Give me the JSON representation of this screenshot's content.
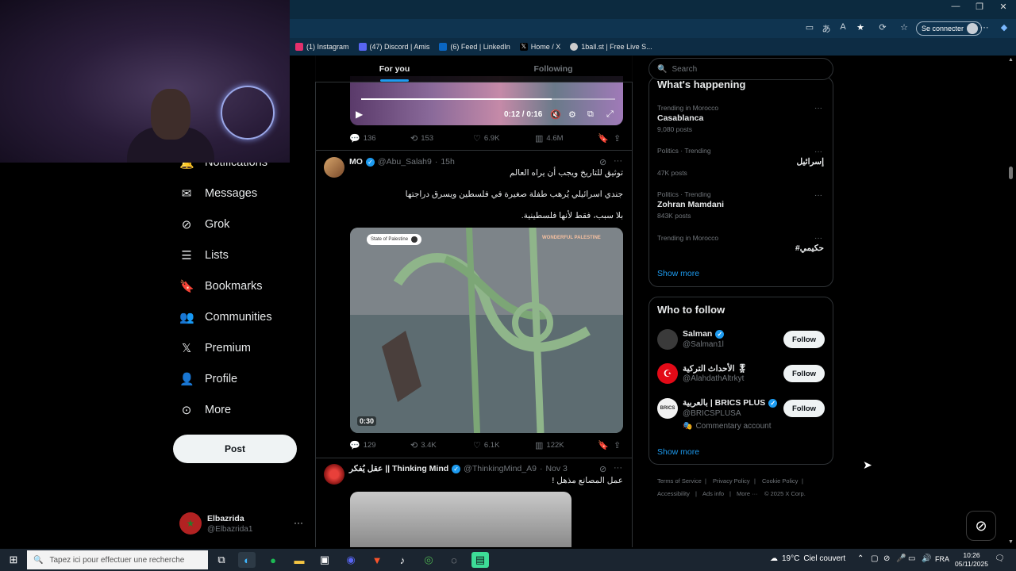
{
  "browser": {
    "window_controls": [
      "minimize",
      "restore",
      "close"
    ],
    "signin_label": "Se connecter",
    "favorites": [
      {
        "label": "(1) Instagram",
        "icon": "instagram-icon",
        "color": "#e1306c"
      },
      {
        "label": "(47) Discord | Amis",
        "icon": "discord-icon",
        "color": "#5865f2"
      },
      {
        "label": "(6) Feed | LinkedIn",
        "icon": "linkedin-icon",
        "color": "#0a66c2"
      },
      {
        "label": "Home / X",
        "icon": "x-icon",
        "color": "#000000"
      },
      {
        "label": "1ball.st | Free Live S...",
        "icon": "globe-icon",
        "color": "#cccccc"
      }
    ]
  },
  "nav": {
    "items": [
      {
        "label": "Notifications",
        "icon": "bell-icon"
      },
      {
        "label": "Messages",
        "icon": "mail-icon"
      },
      {
        "label": "Grok",
        "icon": "grok-icon"
      },
      {
        "label": "Lists",
        "icon": "list-icon"
      },
      {
        "label": "Bookmarks",
        "icon": "bookmark-icon"
      },
      {
        "label": "Communities",
        "icon": "communities-icon"
      },
      {
        "label": "Premium",
        "icon": "x-logo-icon"
      },
      {
        "label": "Profile",
        "icon": "person-icon"
      },
      {
        "label": "More",
        "icon": "more-circle-icon"
      }
    ],
    "post_label": "Post",
    "account": {
      "name": "Elbazrida",
      "handle": "@Elbazrida1"
    }
  },
  "feed": {
    "tabs": [
      {
        "label": "For you",
        "active": true
      },
      {
        "label": "Following",
        "active": false
      }
    ],
    "tweet1": {
      "video_time": "0:12 / 0:16",
      "progress": 0.75,
      "actions": {
        "replies": "136",
        "reposts": "153",
        "likes": "6.9K",
        "views": "4.6M"
      }
    },
    "tweet2": {
      "name": "MO",
      "handle": "@Abu_Salah9",
      "time": "15h",
      "lines": [
        "توثيق للتاريخ ويجب أن يراه العالم",
        "جندي اسرائيلي يُرهب طفلة صغيرة في فلسطين ويسرق دراجتها",
        "بلا سبب، فقط لأنها فلسطينية."
      ],
      "video_tag": "State of Palestine",
      "video_watermark": "WONDERFUL PALESTINE",
      "video_duration": "0:30",
      "actions": {
        "replies": "129",
        "reposts": "3.4K",
        "likes": "6.1K",
        "views": "122K"
      }
    },
    "tweet3": {
      "name": "عقل يُفكر || Thinking Mind",
      "handle": "@ThinkingMind_A9",
      "time": "Nov 3",
      "line": "عمل المصانع مذهل !"
    }
  },
  "sidebar": {
    "search_placeholder": "Search",
    "happening_title": "What's happening",
    "trends": [
      {
        "meta": "Trending in Morocco",
        "title": "Casablanca",
        "count": "9,080 posts"
      },
      {
        "meta": "Politics · Trending",
        "title": "إسرائيل",
        "count": "47K posts"
      },
      {
        "meta": "Politics · Trending",
        "title": "Zohran Mamdani",
        "count": "843K posts"
      },
      {
        "meta": "Trending in Morocco",
        "title": "#حكيمي",
        "count": ""
      }
    ],
    "show_more": "Show more",
    "follow_title": "Who to follow",
    "suggestions": [
      {
        "name": "Salman",
        "handle": "@Salman1l",
        "verified": true,
        "note": "",
        "avatar_color": "#3a3a3a"
      },
      {
        "name": "الأحداث التركية 🎖",
        "handle": "@AlahdathAltrkyt",
        "verified": false,
        "note": "",
        "avatar_color": "#e30a17"
      },
      {
        "name": "بالعربية | BRICS PLUS",
        "handle": "@BRICSPLUSA",
        "verified": true,
        "note": "Commentary account",
        "avatar_color": "#f2f2f2"
      }
    ],
    "follow_label": "Follow",
    "footer": [
      "Terms of Service",
      "Privacy Policy",
      "Cookie Policy",
      "Accessibility",
      "Ads info",
      "More ···",
      "© 2025 X Corp."
    ]
  },
  "taskbar": {
    "search_placeholder": "Tapez ici pour effectuer une recherche",
    "weather_temp": "19°C",
    "weather_text": "Ciel couvert",
    "lang": "FRA",
    "time": "10:26",
    "date": "05/11/2025"
  }
}
